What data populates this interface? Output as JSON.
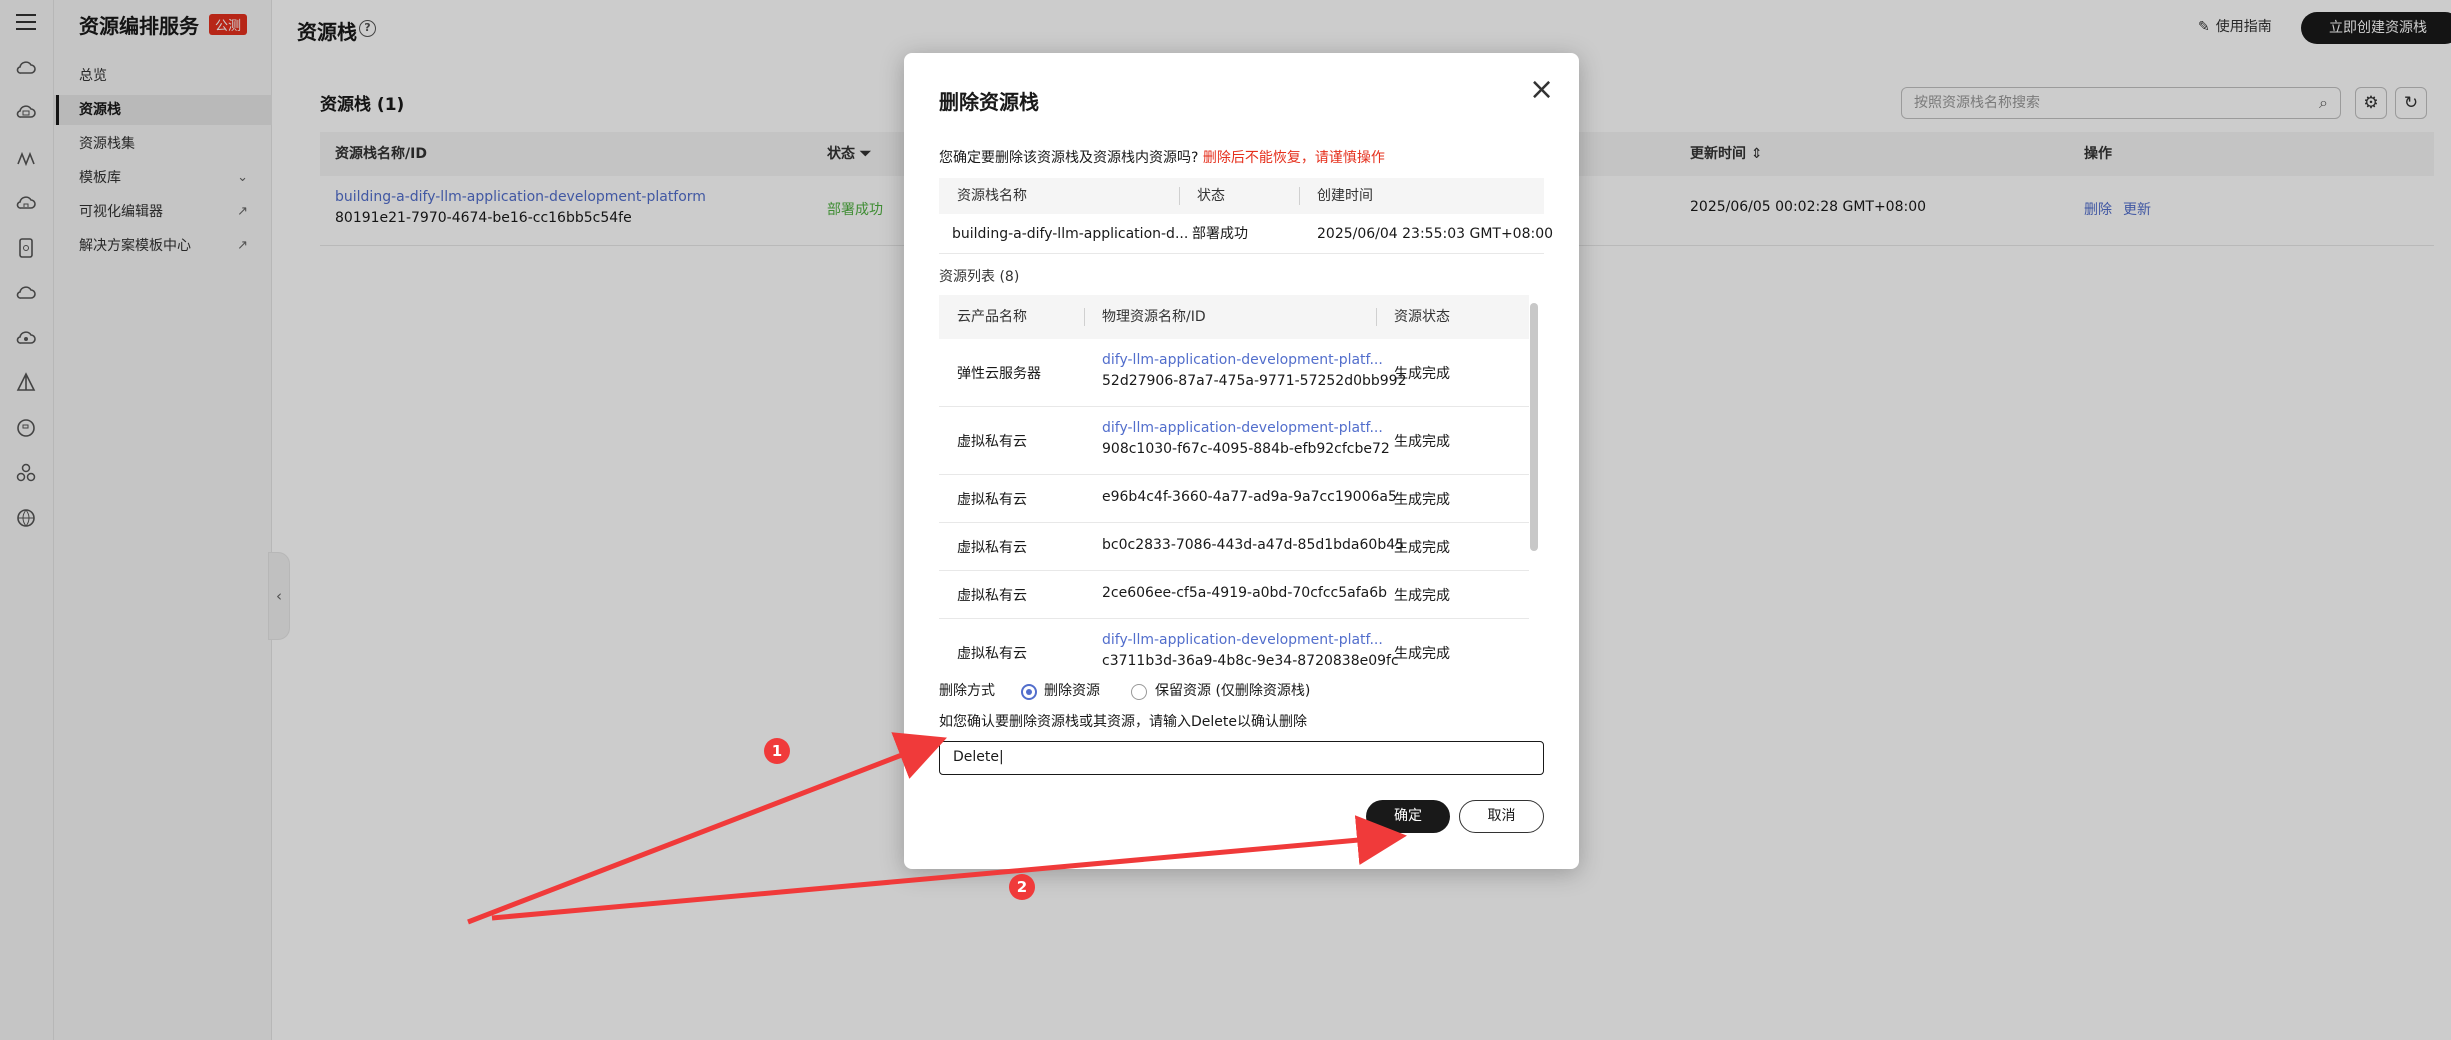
{
  "sidebar": {
    "title": "资源编排服务",
    "badge": "公测",
    "items": [
      {
        "label": "总览"
      },
      {
        "label": "资源栈"
      },
      {
        "label": "资源栈集"
      },
      {
        "label": "模板库"
      },
      {
        "label": "可视化编辑器"
      },
      {
        "label": "解决方案模板中心"
      }
    ]
  },
  "header": {
    "title": "资源栈",
    "help_icon": "question-circle-icon",
    "guide_label": "使用指南",
    "create_label": "立即创建资源栈"
  },
  "list": {
    "title": "资源栈 (1)",
    "search_placeholder": "按照资源栈名称搜索",
    "columns": [
      "资源栈名称/ID",
      "状态",
      "更新时间",
      "操作"
    ],
    "rows": [
      {
        "name": "building-a-dify-llm-application-development-platform",
        "id": "80191e21-7970-4674-be16-cc16bb5c54fe",
        "status": "部署成功",
        "updated": "2025/06/05 00:02:28 GMT+08:00",
        "action_delete": "删除",
        "action_update": "更新"
      }
    ]
  },
  "modal": {
    "title": "删除资源栈",
    "confirm_text": "您确定要删除该资源栈及资源栈内资源吗?",
    "warning_text": "删除后不能恢复，请谨慎操作",
    "stack_table": {
      "columns": [
        "资源栈名称",
        "状态",
        "创建时间"
      ],
      "row": {
        "name": "building-a-dify-llm-application-d...",
        "status": "部署成功",
        "created": "2025/06/04 23:55:03 GMT+08:00"
      }
    },
    "resource_title": "资源列表 (8)",
    "resource_table": {
      "columns": [
        "云产品名称",
        "物理资源名称/ID",
        "资源状态"
      ],
      "rows": [
        {
          "product": "弹性云服务器",
          "name": "dify-llm-application-development-platf...",
          "id": "52d27906-87a7-475a-9771-57252d0bb992",
          "status": "生成完成"
        },
        {
          "product": "虚拟私有云",
          "name": "dify-llm-application-development-platf...",
          "id": "908c1030-f67c-4095-884b-efb92cfcbe72",
          "status": "生成完成"
        },
        {
          "product": "虚拟私有云",
          "name": "",
          "id": "e96b4c4f-3660-4a77-ad9a-9a7cc19006a5",
          "status": "生成完成"
        },
        {
          "product": "虚拟私有云",
          "name": "",
          "id": "bc0c2833-7086-443d-a47d-85d1bda60b45",
          "status": "生成完成"
        },
        {
          "product": "虚拟私有云",
          "name": "",
          "id": "2ce606ee-cf5a-4919-a0bd-70cfcc5afa6b",
          "status": "生成完成"
        },
        {
          "product": "虚拟私有云",
          "name": "dify-llm-application-development-platf...",
          "id": "c3711b3d-36a9-4b8c-9e34-8720838e09fc",
          "status": "生成完成"
        }
      ]
    },
    "delete_method_label": "删除方式",
    "option_delete": "删除资源",
    "option_keep": "保留资源 (仅删除资源栈)",
    "confirm_hint": "如您确认要删除资源栈或其资源，请输入Delete以确认删除",
    "input_value": "Delete",
    "ok_label": "确定",
    "cancel_label": "取消"
  },
  "annotations": {
    "marker_1": "1",
    "marker_2": "2",
    "arrow_color": "#f03a3a"
  }
}
